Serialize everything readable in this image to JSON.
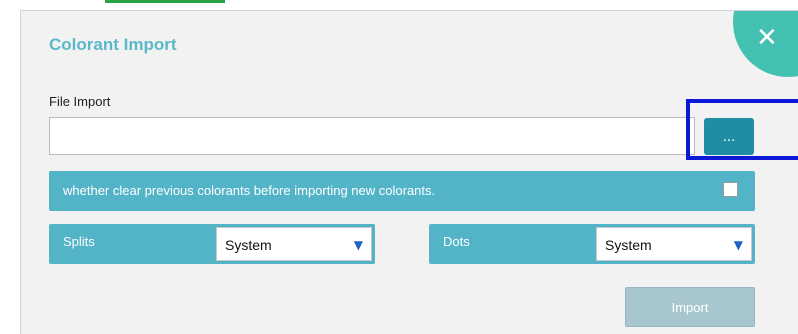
{
  "dialog": {
    "title": "Colorant Import",
    "close_symbol": "✕",
    "close_icon": "close-icon"
  },
  "file_import": {
    "label": "File Import",
    "value": "",
    "placeholder": "",
    "browse_label": "..."
  },
  "clear_option": {
    "label": "whether clear previous colorants before importing new colorants.",
    "checked": false
  },
  "splits": {
    "label": "Splits",
    "selected": "System",
    "arrow": "▼"
  },
  "dots": {
    "label": "Dots",
    "selected": "System",
    "arrow": "▼"
  },
  "actions": {
    "import_label": "Import"
  },
  "colors": {
    "accent": "#53b4c8",
    "title": "#5bb8c9",
    "close_corner": "#45c1b2",
    "browse_button": "#1f8ea5",
    "highlight_box": "#0b18d6",
    "import_disabled": "#a8c6cd"
  }
}
